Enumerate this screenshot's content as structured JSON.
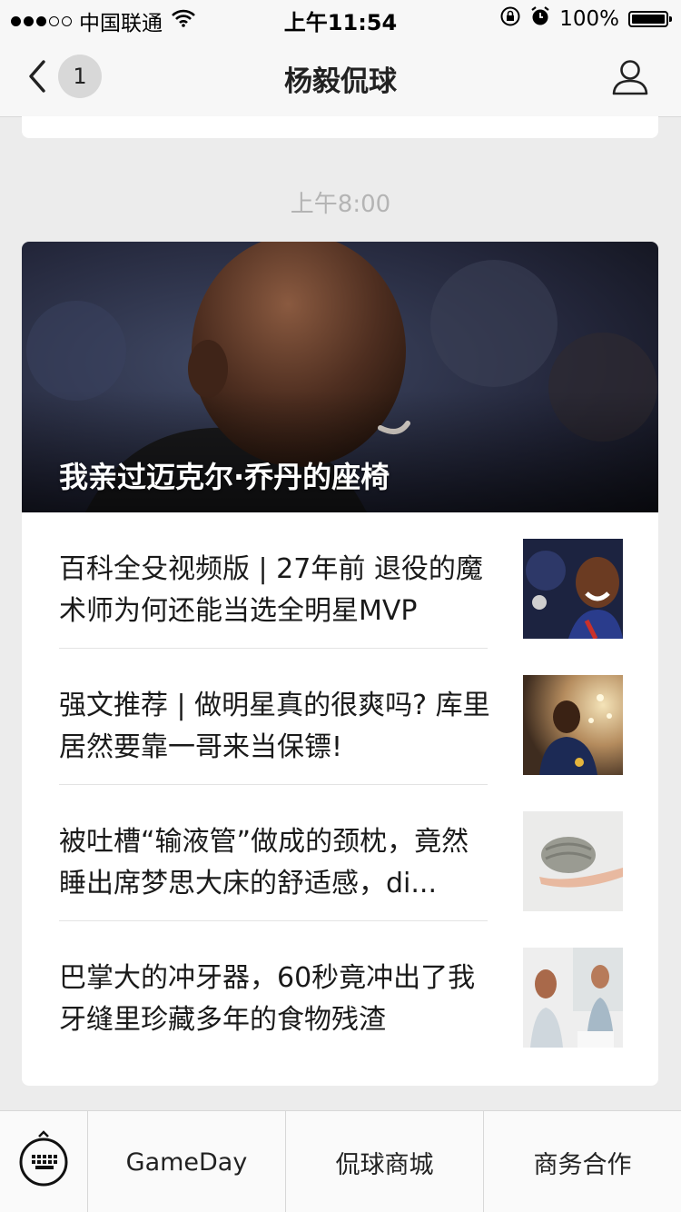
{
  "status_bar": {
    "signal_filled": 3,
    "signal_total": 5,
    "carrier": "中国联通",
    "time": "上午11:54",
    "battery_text": "100%",
    "battery_level": 1.0,
    "icons": [
      "wifi-icon",
      "lock-rotation-icon",
      "alarm-icon",
      "battery-icon"
    ]
  },
  "nav": {
    "title": "杨毅侃球",
    "unread_count": "1",
    "icons": [
      "back-chevron-icon",
      "profile-icon"
    ]
  },
  "chat": {
    "timestamp": "上午8:00",
    "hero_title": "我亲过迈克尔·乔丹的座椅",
    "articles": [
      {
        "title": "百科全殳视频版 | 27年前 退役的魔术师为何还能当选全明星MVP",
        "thumb": "smiling-player-photo"
      },
      {
        "title": "强文推荐 | 做明星真的很爽吗? 库里居然要靠一哥来当保镖!",
        "thumb": "player-with-lights-photo"
      },
      {
        "title": "被吐槽“输液管”做成的颈枕，竟然睡出席梦思大床的舒适感，di...",
        "thumb": "neck-pillow-photo"
      },
      {
        "title": "巴掌大的冲牙器，60秒竟冲出了我牙缝里珍藏多年的食物残渣",
        "thumb": "bathroom-women-photo"
      }
    ]
  },
  "bottom_menu": {
    "keyboard_icon": "keyboard-icon",
    "items": [
      "GameDay",
      "侃球商城",
      "商务合作"
    ]
  }
}
